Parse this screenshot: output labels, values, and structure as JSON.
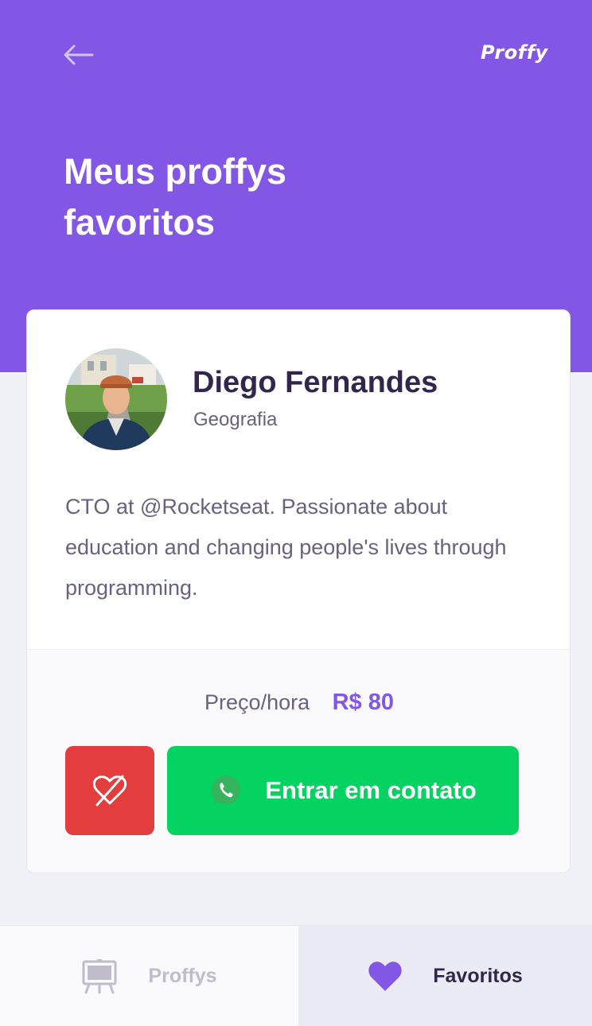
{
  "header": {
    "logo": "Proffy",
    "title": "Meus proffys favoritos",
    "background_color": "#8257e5",
    "back_icon": "arrow-left-icon"
  },
  "teacher_card": {
    "name": "Diego Fernandes",
    "subject": "Geografia",
    "bio": "CTO at @Rocketseat. Passionate about education and changing people's lives through programming.",
    "price_label": "Preço/hora",
    "price_value": "R$ 80",
    "unfavorite_icon": "heart-outline-off-icon",
    "contact_label": "Entrar em contato",
    "contact_icon": "whatsapp-icon",
    "colors": {
      "unfavorite": "#e33d3d",
      "contact": "#04d361",
      "price": "#8257e5"
    }
  },
  "tabs": [
    {
      "label": "Proffys",
      "icon": "easel-icon",
      "active": false
    },
    {
      "label": "Favoritos",
      "icon": "heart-icon",
      "active": true
    }
  ]
}
